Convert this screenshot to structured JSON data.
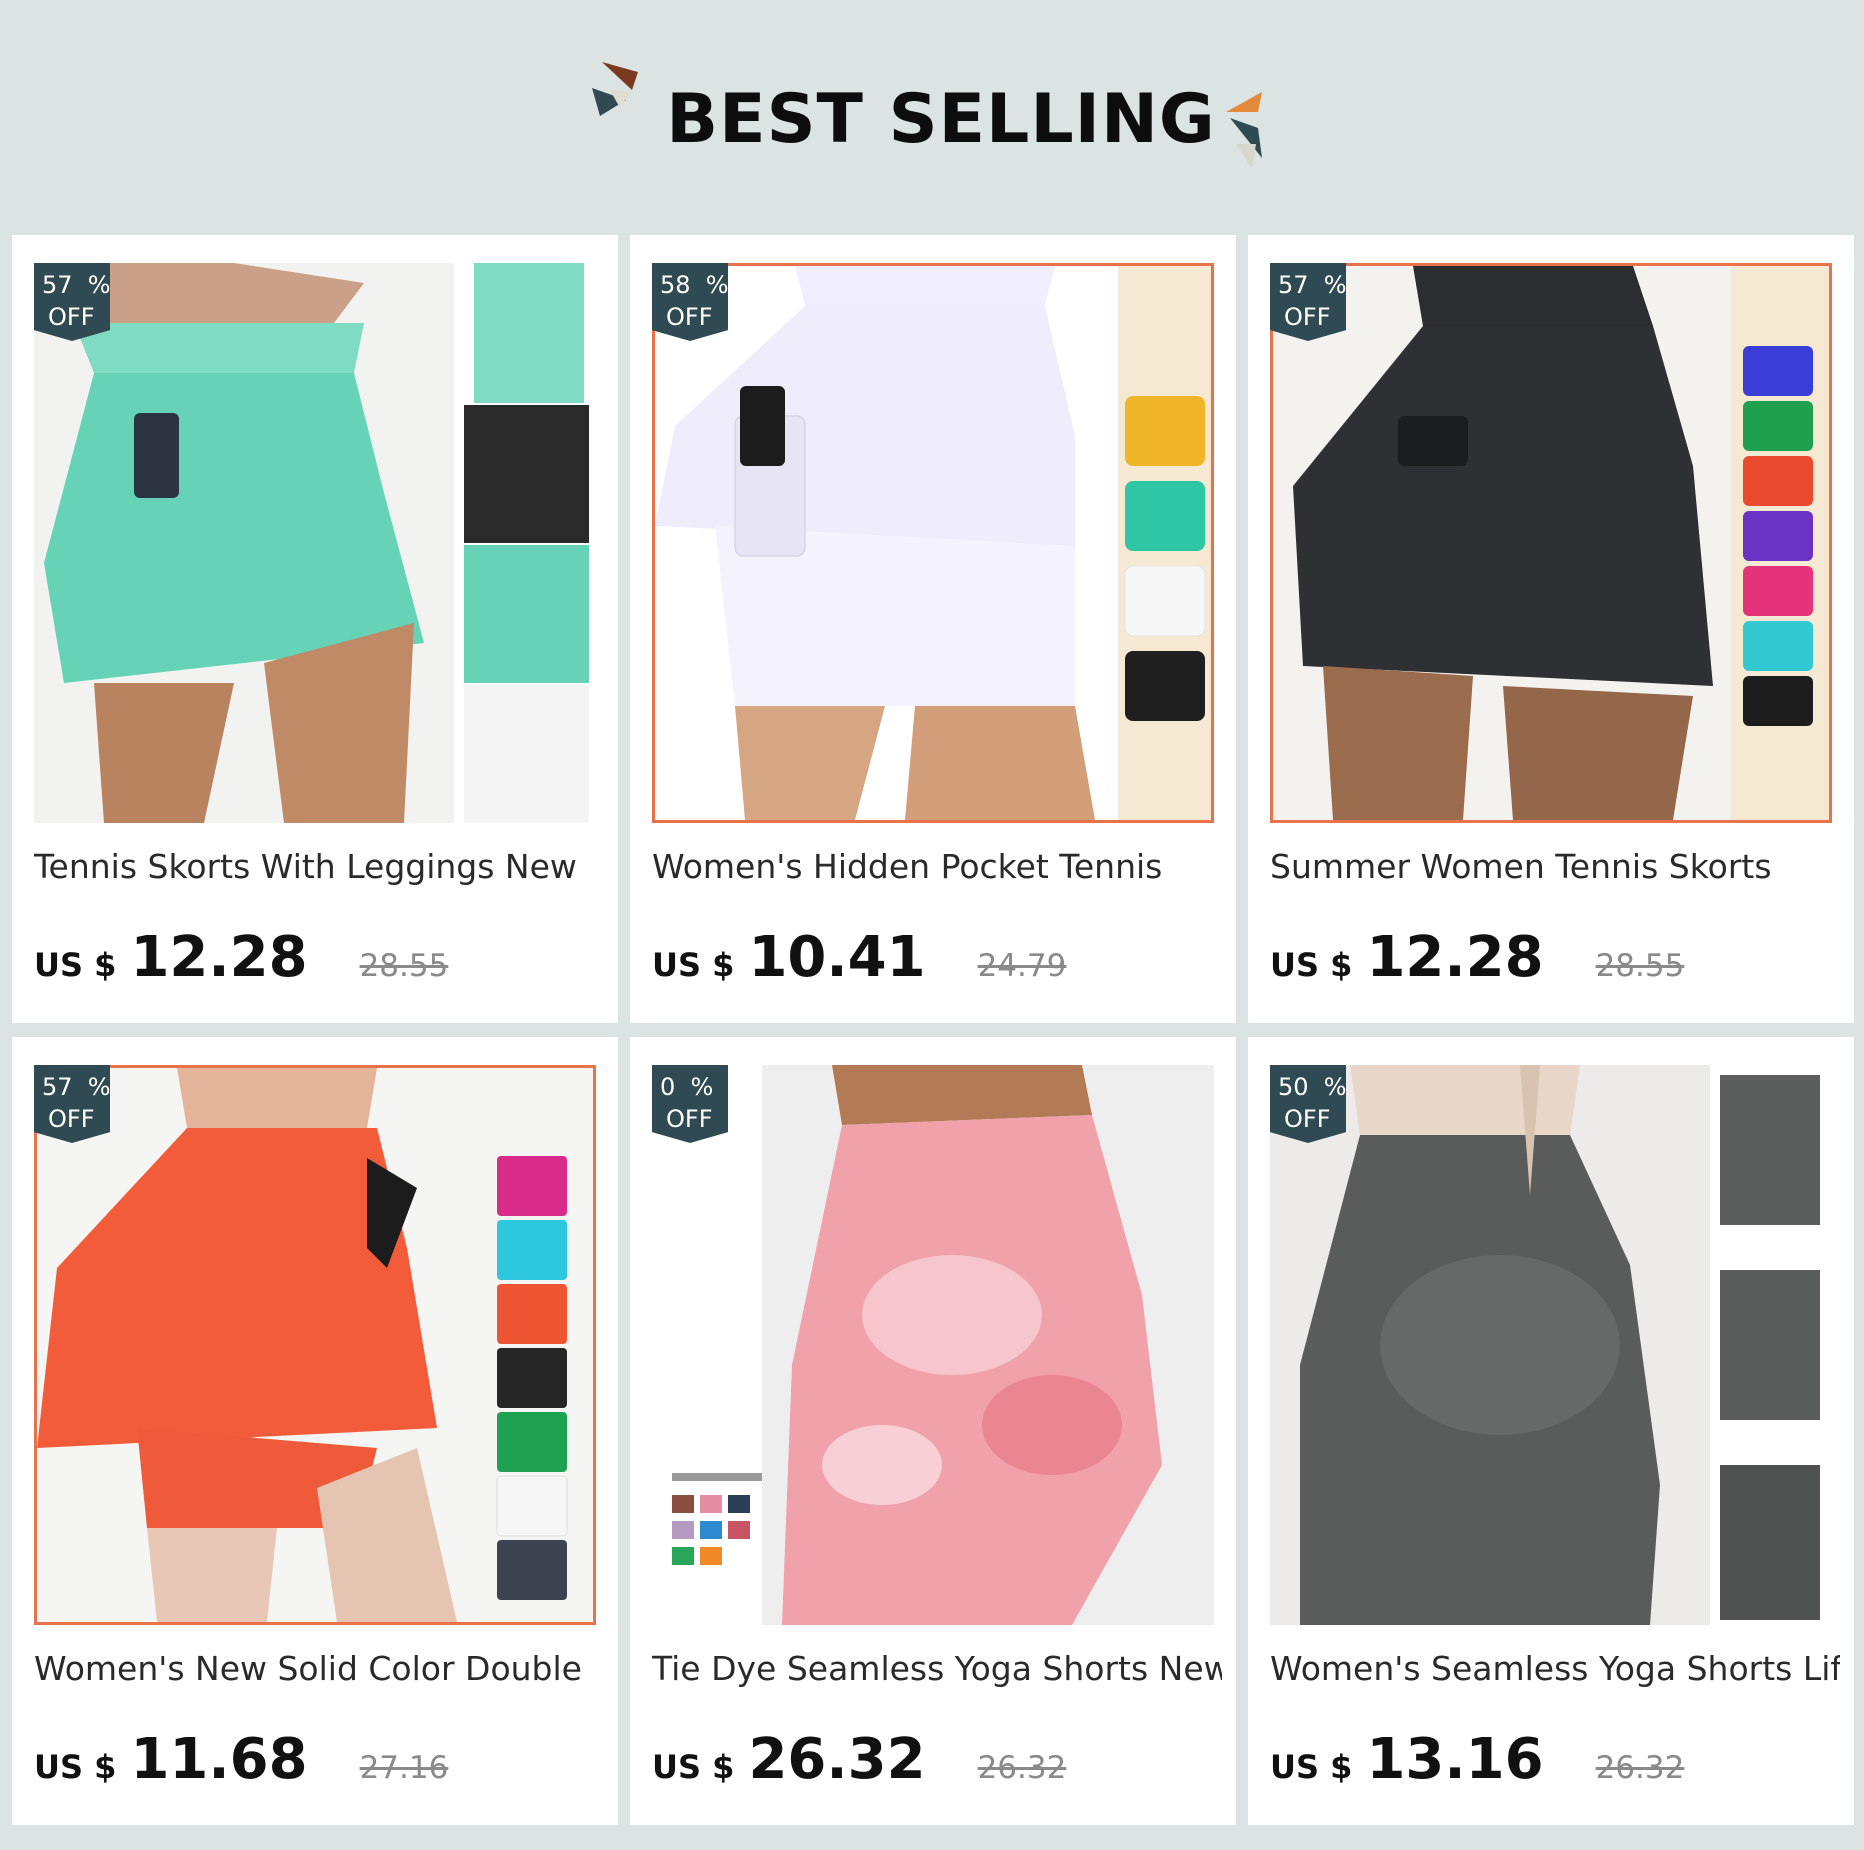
{
  "header": {
    "title": "BEST SELLING"
  },
  "products": [
    {
      "discount": "57  %",
      "off": "OFF",
      "name": "Tennis Skorts With Leggings New",
      "currency": "US $",
      "price": "12.28",
      "original_price": "28.55",
      "image": "mint-green-tennis-skort-photo"
    },
    {
      "discount": "58  %",
      "off": "OFF",
      "name": "Women's Hidden Pocket Tennis",
      "currency": "US $",
      "price": "10.41",
      "original_price": "24.79",
      "image": "white-tennis-skort-photo"
    },
    {
      "discount": "57  %",
      "off": "OFF",
      "name": "Summer Women Tennis Skorts",
      "currency": "US $",
      "price": "12.28",
      "original_price": "28.55",
      "image": "black-tennis-skort-photo"
    },
    {
      "discount": "57  %",
      "off": "OFF",
      "name": "Women's New Solid Color Double",
      "currency": "US $",
      "price": "11.68",
      "original_price": "27.16",
      "image": "orange-double-layer-shorts-photo"
    },
    {
      "discount": "0  %",
      "off": "OFF",
      "name": "Tie Dye Seamless Yoga Shorts New",
      "currency": "US $",
      "price": "26.32",
      "original_price": "26.32",
      "image": "pink-tie-dye-yoga-shorts-photo"
    },
    {
      "discount": "50  %",
      "off": "OFF",
      "name": "Women's Seamless Yoga Shorts Lift",
      "currency": "US $",
      "price": "13.16",
      "original_price": "26.32",
      "image": "grey-seamless-yoga-shorts-photo"
    }
  ],
  "colors": {
    "accent_border": "#e8734a",
    "badge_bg": "#2f4a52",
    "page_bg": "#dbe3e3"
  }
}
